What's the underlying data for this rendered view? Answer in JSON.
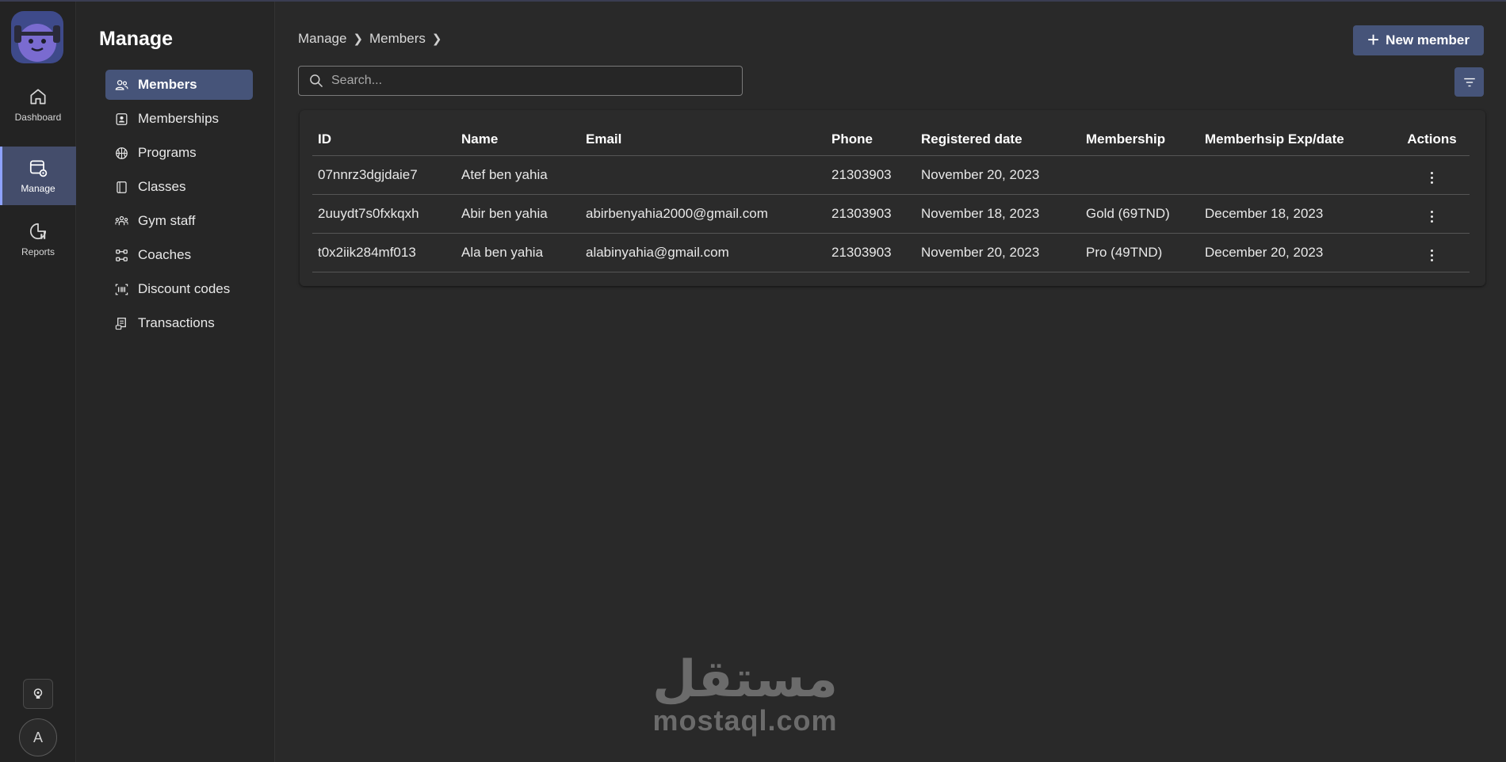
{
  "rail": {
    "items": [
      {
        "label": "Dashboard",
        "icon": "home-icon"
      },
      {
        "label": "Manage",
        "icon": "manage-icon",
        "active": true
      },
      {
        "label": "Reports",
        "icon": "reports-icon"
      }
    ],
    "avatar_initial": "A"
  },
  "sidebar": {
    "title": "Manage",
    "items": [
      {
        "label": "Members",
        "icon": "people-icon",
        "active": true
      },
      {
        "label": "Memberships",
        "icon": "badge-icon"
      },
      {
        "label": "Programs",
        "icon": "basketball-icon"
      },
      {
        "label": "Classes",
        "icon": "book-icon"
      },
      {
        "label": "Gym staff",
        "icon": "team-icon"
      },
      {
        "label": "Coaches",
        "icon": "dumbbell-icon"
      },
      {
        "label": "Discount codes",
        "icon": "barcode-icon"
      },
      {
        "label": "Transactions",
        "icon": "receipt-icon"
      }
    ]
  },
  "header": {
    "breadcrumb": [
      "Manage",
      "Members"
    ],
    "new_button_label": "New member"
  },
  "search": {
    "placeholder": "Search..."
  },
  "table": {
    "columns": [
      "ID",
      "Name",
      "Email",
      "Phone",
      "Registered date",
      "Membership",
      "Memberhsip Exp/date",
      "Actions"
    ],
    "rows": [
      {
        "id": "07nnrz3dgjdaie7",
        "name": "Atef ben yahia",
        "email": "",
        "phone": "21303903",
        "registered": "November 20, 2023",
        "membership": "",
        "exp": ""
      },
      {
        "id": "2uuydt7s0fxkqxh",
        "name": "Abir ben yahia",
        "email": "abirbenyahia2000@gmail.com",
        "phone": "21303903",
        "registered": "November 18, 2023",
        "membership": "Gold (69TND)",
        "exp": "December 18, 2023"
      },
      {
        "id": "t0x2iik284mf013",
        "name": "Ala ben yahia",
        "email": "alabinyahia@gmail.com",
        "phone": "21303903",
        "registered": "November 20, 2023",
        "membership": "Pro (49TND)",
        "exp": "December 20, 2023"
      }
    ]
  },
  "watermark": {
    "arabic": "مستقل",
    "latin": "mostaql.com"
  },
  "colors": {
    "accent": "#465479",
    "rail_bg": "#232323",
    "main_bg": "#292929"
  }
}
